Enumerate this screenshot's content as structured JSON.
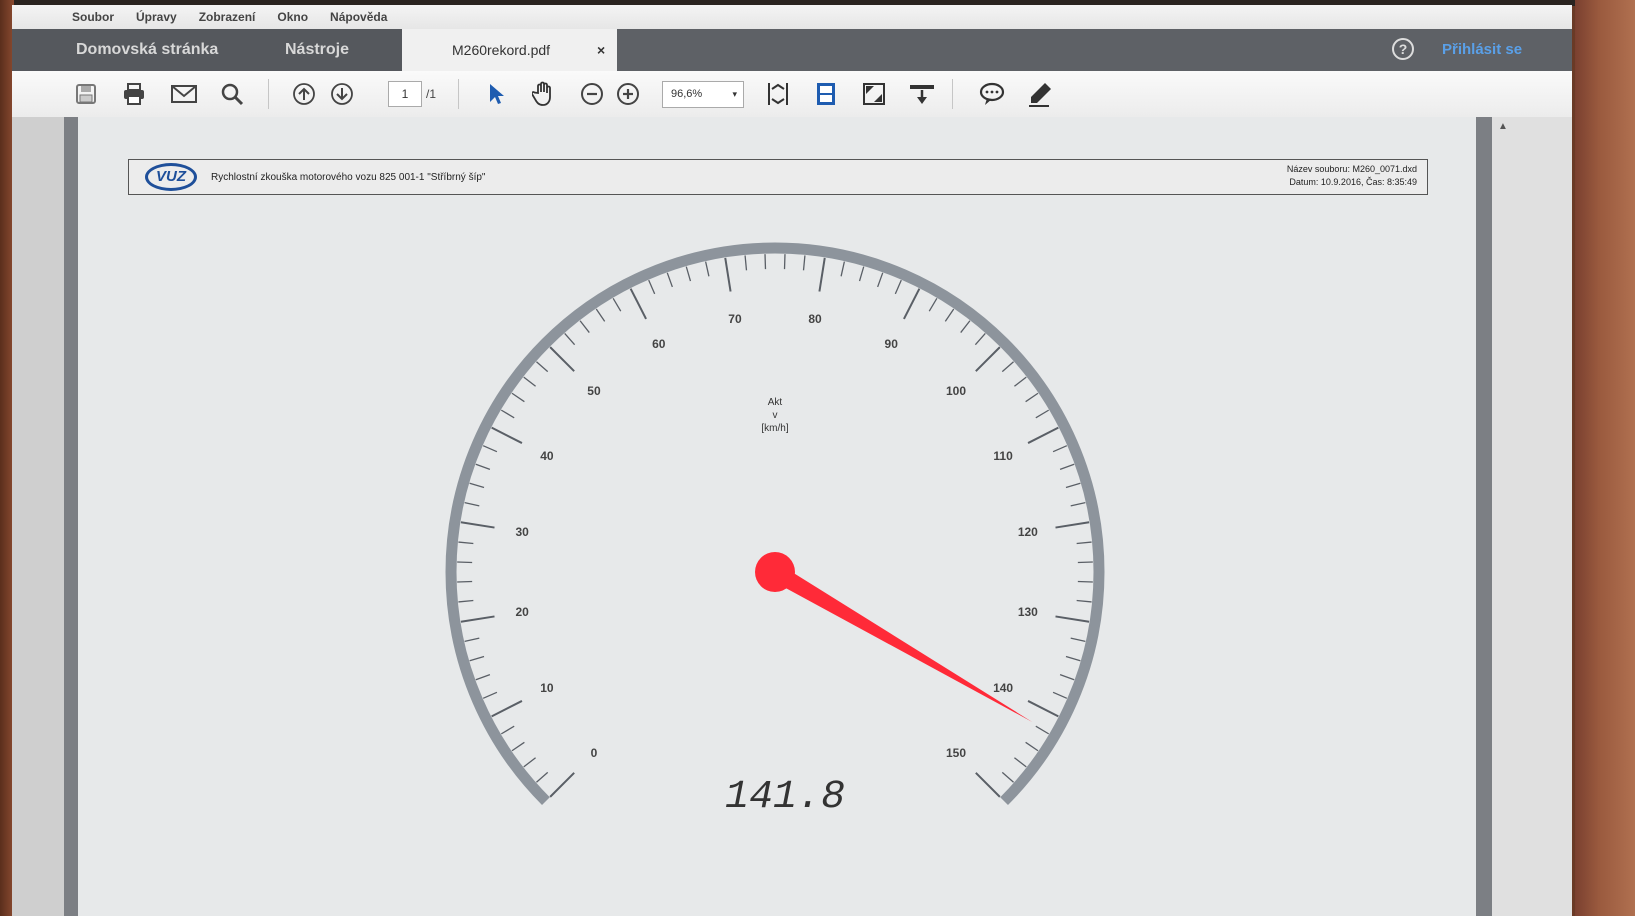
{
  "menu": [
    "Soubor",
    "Úpravy",
    "Zobrazení",
    "Okno",
    "Nápověda"
  ],
  "tabs": {
    "home": "Domovská stránka",
    "tools": "Nástroje",
    "document": "M260rekord.pdf",
    "close": "×"
  },
  "header_right": {
    "help": "?",
    "signin": "Přihlásit se"
  },
  "toolbar": {
    "page_current": "1",
    "page_total": "/1",
    "zoom": "96,6%",
    "zoom_caret": "▾"
  },
  "document": {
    "logo": "VUZ",
    "title": "Rychlostní zkouška motorového vozu 825 001-1 \"Stříbrný šíp\"",
    "file_line": "Název souboru: M260_0071.dxd",
    "date_line": "Datum: 10.9.2016, Čas: 8:35:49"
  },
  "gauge": {
    "label_line1": "Akt",
    "label_line2": "v",
    "label_line3": "[km/h]",
    "min": 0,
    "max": 150,
    "major_step": 10,
    "value": 141.8,
    "value_text": "141.8",
    "needle_color": "#ff2a38",
    "tick_labels": [
      "0",
      "10",
      "20",
      "30",
      "40",
      "50",
      "60",
      "70",
      "80",
      "90",
      "100",
      "110",
      "120",
      "130",
      "140",
      "150"
    ]
  }
}
